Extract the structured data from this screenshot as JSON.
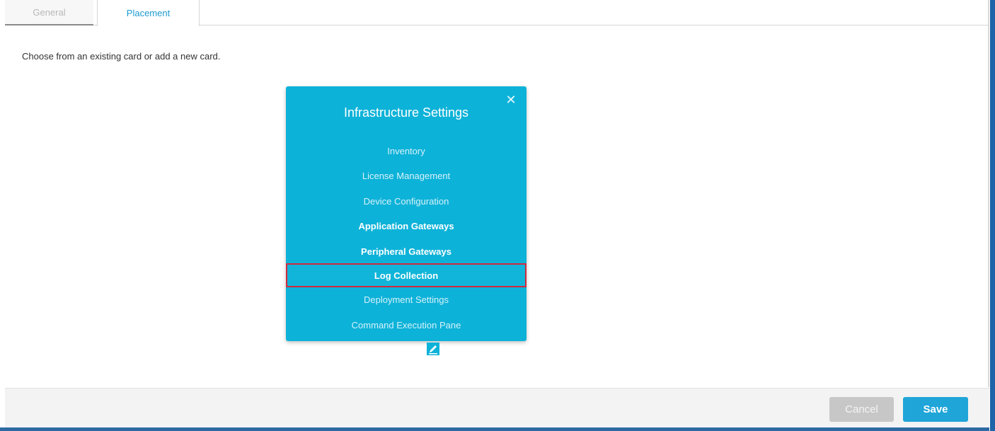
{
  "tabs": [
    {
      "label": "General",
      "active": false
    },
    {
      "label": "Placement",
      "active": true
    }
  ],
  "instruction": "Choose from an existing card or add a new card.",
  "card": {
    "title": "Infrastructure Settings",
    "close_icon": "close-icon",
    "items": [
      {
        "label": "Inventory"
      },
      {
        "label": "License Management"
      },
      {
        "label": "Device Configuration"
      },
      {
        "label": "Application Gateways"
      },
      {
        "label": "Peripheral Gateways"
      },
      {
        "label": "Log Collection"
      },
      {
        "label": "Deployment Settings"
      },
      {
        "label": "Command Execution Pane"
      }
    ],
    "selected_item": "Log Collection",
    "edit_icon": "edit-icon"
  },
  "footer": {
    "cancel_label": "Cancel",
    "save_label": "Save"
  },
  "colors": {
    "card_bg": "#0db2d8",
    "accent": "#1fa5d8",
    "selection_border": "#cf2a3d"
  }
}
